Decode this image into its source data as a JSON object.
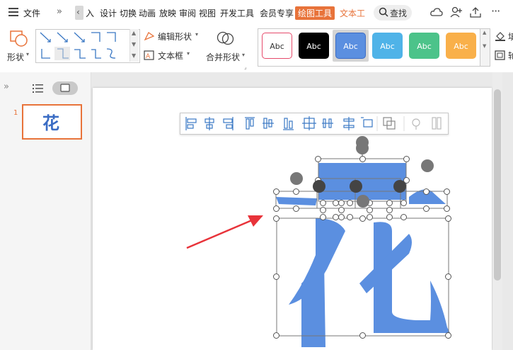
{
  "menubar": {
    "file_label": "文件",
    "items": [
      "入",
      "设计",
      "切换",
      "动画",
      "放映",
      "审阅",
      "视图",
      "开发工具",
      "会员专享"
    ],
    "drawing_tools": "绘图工具",
    "text_tools": "文本工",
    "search_label": "查找"
  },
  "ribbon": {
    "shape_label": "形状",
    "edit_shape_label": "编辑形状",
    "textbox_label": "文本框",
    "merge_shape_label": "合并形状",
    "style_presets": [
      {
        "label": "Abc",
        "fill": "#ffffff",
        "border": "#e64a6b",
        "text_color": "#333333"
      },
      {
        "label": "Abc",
        "fill": "#000000",
        "border": "#000000",
        "text_color": "#ffffff"
      },
      {
        "label": "Abc",
        "fill": "#5b8fe0",
        "border": "#3c6cc4",
        "text_color": "#ffffff"
      },
      {
        "label": "Abc",
        "fill": "#4fb3e8",
        "border": "#4fb3e8",
        "text_color": "#ffffff"
      },
      {
        "label": "Abc",
        "fill": "#4cc38a",
        "border": "#4cc38a",
        "text_color": "#ffffff"
      },
      {
        "label": "Abc",
        "fill": "#f9b04a",
        "border": "#f9b04a",
        "text_color": "#ffffff"
      }
    ],
    "right_label_1": "填",
    "right_label_2": "轮"
  },
  "left_panel": {
    "slide_number": "1",
    "thumbnail_char": "花"
  },
  "slide": {
    "shape_color": "#5b8fe0",
    "arrow_color": "#e8333a"
  }
}
